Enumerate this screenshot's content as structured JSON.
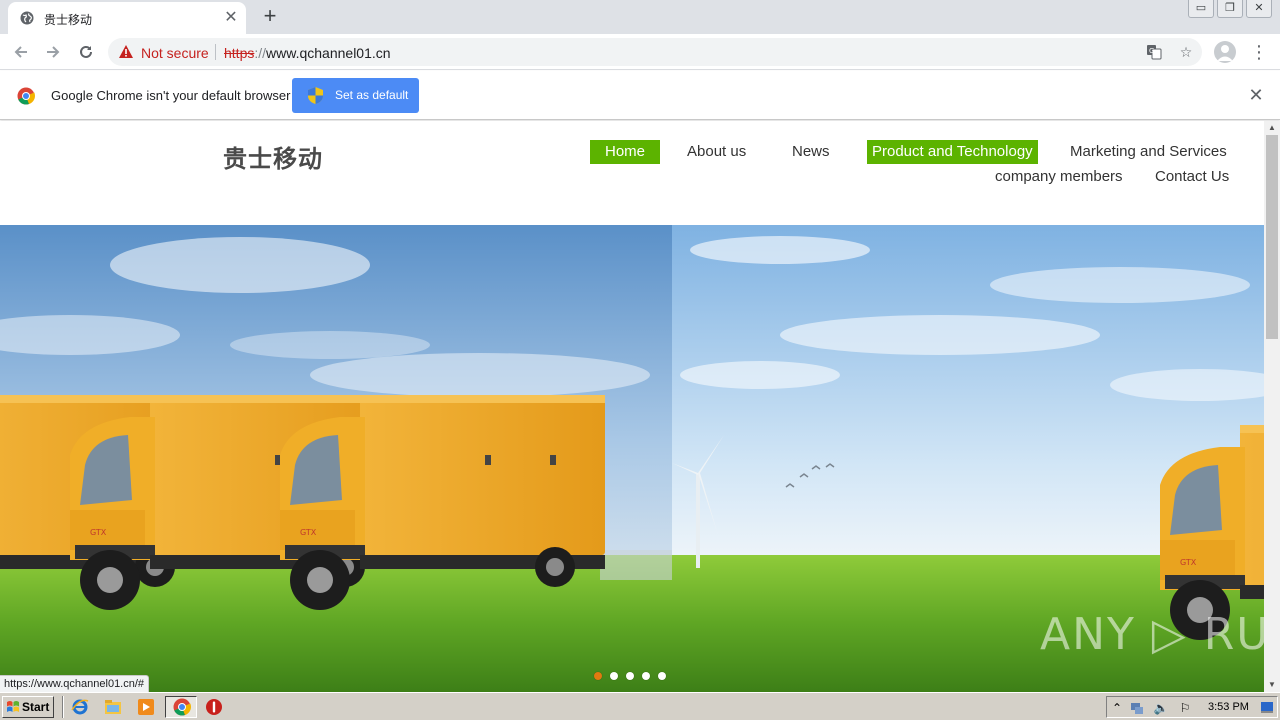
{
  "browser": {
    "tab": {
      "title": "贵士移动",
      "favicon": "globe-icon"
    },
    "address": {
      "security_label": "Not secure",
      "url_scheme": "https",
      "url_separator": "://",
      "url_host": "www.qchannel01.cn"
    },
    "window_controls": {
      "minimize": "▭",
      "restore": "❐",
      "close": "✕"
    }
  },
  "infobar": {
    "message": "Google Chrome isn't your default browser",
    "button_label": "Set as default"
  },
  "site": {
    "logo_text": "贵士移动",
    "nav": [
      {
        "label": "Home",
        "active": true
      },
      {
        "label": "About us",
        "active": false
      },
      {
        "label": "News",
        "active": false
      },
      {
        "label": "Product and Technology",
        "active": true
      },
      {
        "label": "Marketing and Services",
        "active": false
      },
      {
        "label": "company members",
        "active": false
      },
      {
        "label": "Contact Us",
        "active": false
      }
    ],
    "slider": {
      "slide_count": 5,
      "active_index": 0
    },
    "watermark": "ANY ▷ RUN"
  },
  "status_bar": {
    "hover_url": "https://www.qchannel01.cn/#"
  },
  "taskbar": {
    "start_label": "Start",
    "clock": "3:53 PM",
    "quick_launch": [
      "ie-icon",
      "explorer-icon",
      "media-player-icon",
      "chrome-icon",
      "stop-icon"
    ]
  },
  "colors": {
    "nav_active": "#5cb300",
    "infobar_button": "#4c8bf5",
    "security_warning": "#c5221f",
    "slider_active_dot": "#e07a10"
  }
}
